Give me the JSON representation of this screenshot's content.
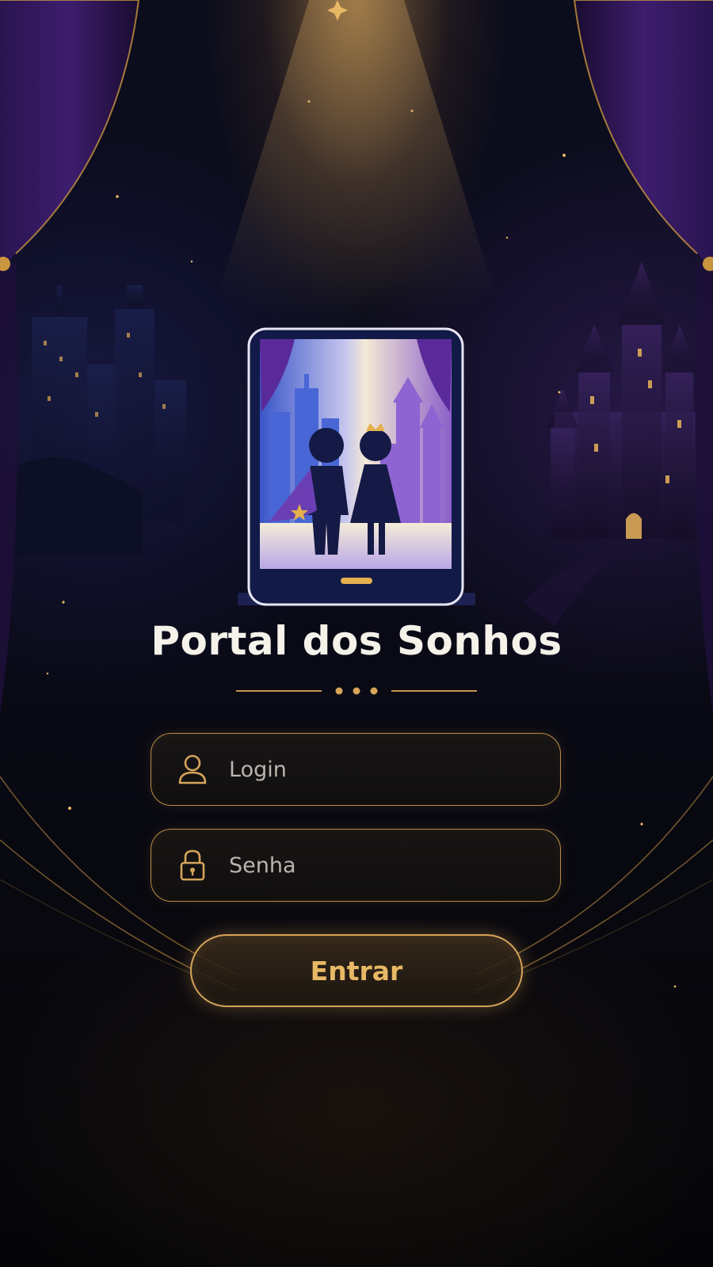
{
  "app": {
    "title": "Portal dos Sonhos"
  },
  "form": {
    "login_placeholder": "Login",
    "password_placeholder": "Senha",
    "submit_label": "Entrar"
  },
  "icons": {
    "login": "user-icon",
    "password": "lock-icon",
    "logo": "tablet-portal-logo"
  },
  "colors": {
    "gold_accent": "#d6a45a",
    "title_text": "#f5f2ea",
    "background": "#07080f"
  }
}
